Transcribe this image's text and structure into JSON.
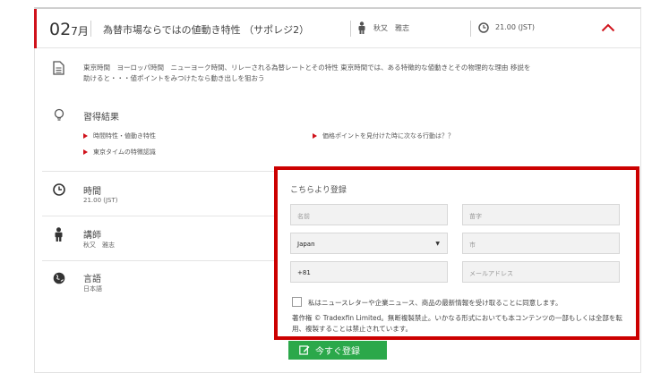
{
  "session": {
    "day": "02",
    "month": "7月",
    "title": "為替市場ならではの値動き特性 （サポレジ2）",
    "instructor": "秋又　雅志",
    "time": "21.00 (JST)"
  },
  "intro": "東京時間　ヨーロッパ時間　ニューヨーク時間、リレーされる為替レートとその特性 東京時間では、ある特徴的な値動きとその物理的な理由 移説を助けると・・・値ポイントをみつけたなら動き出しを狙おう",
  "learning": {
    "title": "習得結果",
    "bullets": [
      "時間特性・値動き特性",
      "価格ポイントを見付けた時に次なる行動は？？",
      "東京タイムの特徴認識"
    ]
  },
  "info": {
    "time_label": "時間",
    "time_value": "21.00 (JST)",
    "instructor_label": "講師",
    "instructor_value": "秋又　雅志",
    "language_label": "言語",
    "language_value": "日本語"
  },
  "form": {
    "title": "こちらより登録",
    "first_name_placeholder": "名前",
    "last_name_placeholder": "苗字",
    "country_value": "Japan",
    "city_placeholder": "市",
    "phone_value": "+81",
    "email_placeholder": "メールアドレス",
    "consent": "私はニュースレターや企業ニュース、商品の最新情報を受け取ることに同意します。",
    "legal": "著作権 © Tradexfin Limited。無断複製禁止。いかなる形式においても本コンテンツの一部もしくは全部を転用、複製することは禁止されています。",
    "submit": "今すぐ登録"
  },
  "colors": {
    "accent": "#d0121b",
    "highlight_border": "#cc0000",
    "submit": "#2ba84a"
  },
  "icons": [
    "person-icon",
    "clock-icon",
    "chevron-up-icon",
    "document-icon",
    "lightbulb-icon",
    "globe-icon",
    "pencil-icon"
  ]
}
